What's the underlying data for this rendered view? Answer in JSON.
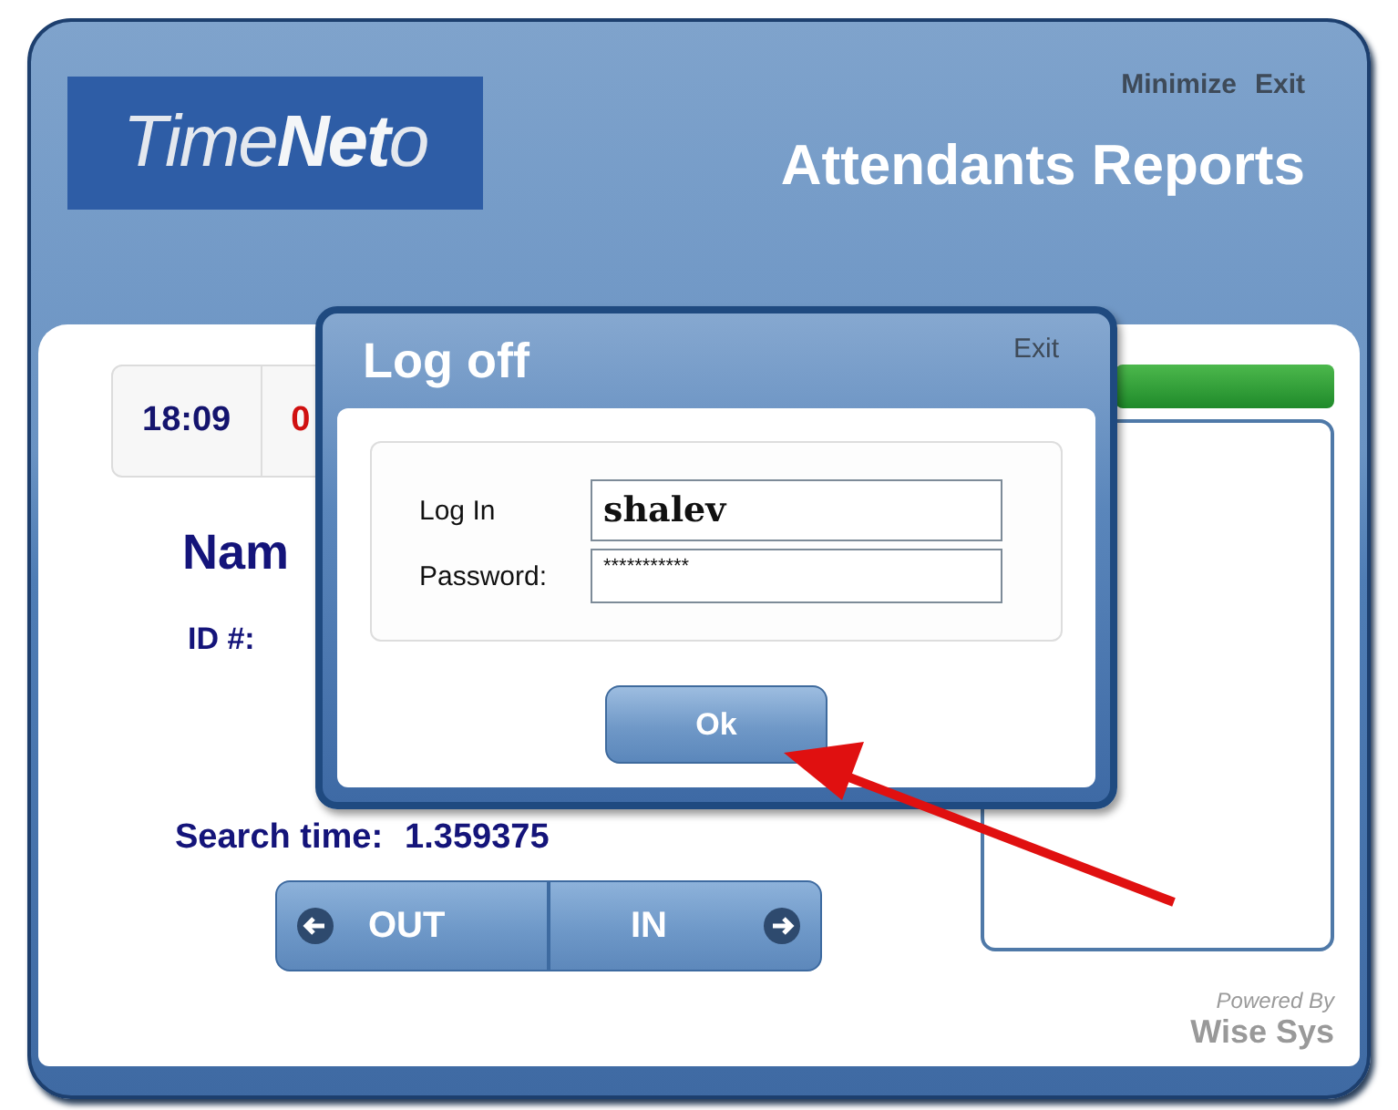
{
  "window": {
    "logo": "Time**Net**o",
    "title": "Attendants Reports",
    "controls": [
      "Minimize",
      "Exit"
    ]
  },
  "clock": {
    "time": "18:09",
    "column_2": "0"
  },
  "name_label": "Nam",
  "id_label": "ID #:",
  "search_time": {
    "label": "Search time:",
    "value": "1.359375"
  },
  "buttons": [
    {
      "label": "OUT",
      "kind": "left"
    },
    {
      "label": "IN",
      "kind": "right"
    }
  ],
  "footer": {
    "caption": "Powered By",
    "brand": "Wise Sys"
  },
  "dialog": {
    "title": "Log off",
    "close": "Exit",
    "fields": [
      {
        "label": "Log In",
        "value": "shalev",
        "kind": "text"
      },
      {
        "label": "Password:",
        "value": "***********",
        "kind": "password"
      }
    ],
    "button": "Ok"
  }
}
